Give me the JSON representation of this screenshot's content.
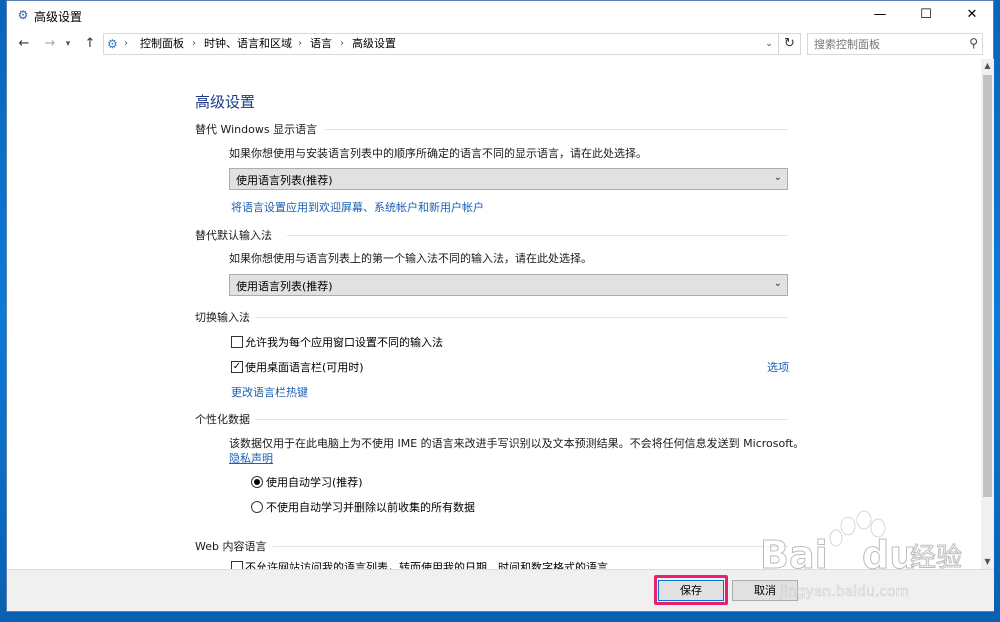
{
  "window": {
    "title": "高级设置"
  },
  "nav": {
    "breadcrumbs": [
      "控制面板",
      "时钟、语言和区域",
      "语言",
      "高级设置"
    ],
    "search_placeholder": "搜索控制面板"
  },
  "page": {
    "title": "高级设置",
    "sections": {
      "display_lang": {
        "heading": "替代 Windows 显示语言",
        "desc": "如果你想使用与安装语言列表中的顺序所确定的语言不同的显示语言，请在此处选择。",
        "select_value": "使用语言列表(推荐)",
        "link": "将语言设置应用到欢迎屏幕、系统帐户和新用户帐户"
      },
      "input_method": {
        "heading": "替代默认输入法",
        "desc": "如果你想使用与语言列表上的第一个输入法不同的输入法，请在此处选择。",
        "select_value": "使用语言列表(推荐)"
      },
      "switch_input": {
        "heading": "切换输入法",
        "cb1_label": "允许我为每个应用窗口设置不同的输入法",
        "cb1_checked": false,
        "cb2_label": "使用桌面语言栏(可用时)",
        "cb2_checked": true,
        "options_link": "选项",
        "hotkey_link": "更改语言栏热键"
      },
      "personal": {
        "heading": "个性化数据",
        "desc": "该数据仅用于在此电脑上为不使用 IME 的语言来改进手写识别以及文本预测结果。不会将任何信息发送到 Microsoft。",
        "privacy_link": "隐私声明",
        "radio1_label": "使用自动学习(推荐)",
        "radio1_selected": true,
        "radio2_label": "不使用自动学习并删除以前收集的所有数据",
        "radio2_selected": false
      },
      "web": {
        "heading": "Web 内容语言",
        "cb_label": "不允许网站访问我的语言列表，转而使用我的日期、时间和数字格式的语言",
        "cb_checked": false
      }
    }
  },
  "footer": {
    "save": "保存",
    "cancel": "取消"
  },
  "watermark": {
    "brand": "Bai",
    "brand2": "du",
    "cn": "经验",
    "url": "jingyan.baidu.com"
  },
  "colors": {
    "link": "#1a5fb4",
    "title": "#1e3a8a",
    "highlight": "#e8206e"
  }
}
